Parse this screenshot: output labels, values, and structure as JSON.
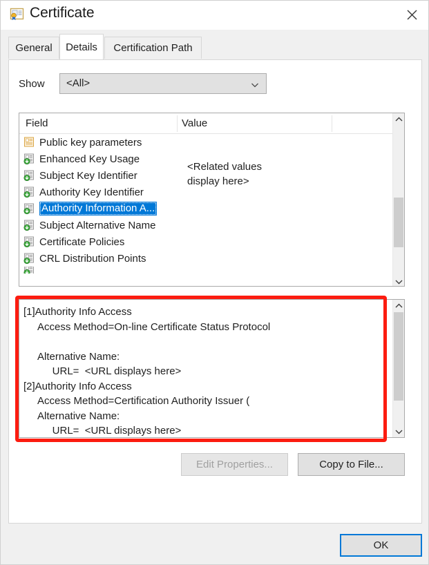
{
  "window": {
    "title": "Certificate",
    "icon": "certificate-icon",
    "close_label": "✕"
  },
  "tabs": [
    {
      "label": "General",
      "selected": false
    },
    {
      "label": "Details",
      "selected": true
    },
    {
      "label": "Certification Path",
      "selected": false
    }
  ],
  "show": {
    "label": "Show",
    "selected_value": "<All>",
    "options": [
      "<All>"
    ]
  },
  "field_list": {
    "columns": [
      "Field",
      "Value"
    ],
    "value_text": "<Related values\ndisplay here>",
    "rows": [
      {
        "label": "Public key parameters",
        "icon": "cert-field-icon-tan",
        "selected": false
      },
      {
        "label": "Enhanced Key Usage",
        "icon": "cert-field-icon",
        "selected": false
      },
      {
        "label": "Subject Key Identifier",
        "icon": "cert-field-icon",
        "selected": false
      },
      {
        "label": "Authority Key Identifier",
        "icon": "cert-field-icon",
        "selected": false
      },
      {
        "label": "Authority Information A...",
        "icon": "cert-field-icon",
        "selected": true
      },
      {
        "label": "Subject Alternative Name",
        "icon": "cert-field-icon",
        "selected": false
      },
      {
        "label": "Certificate Policies",
        "icon": "cert-field-icon",
        "selected": false
      },
      {
        "label": "CRL Distribution Points",
        "icon": "cert-field-icon",
        "selected": false
      }
    ]
  },
  "detail": {
    "text": "[1]Authority Info Access\n     Access Method=On-line Certificate Status Protocol\n\n     Alternative Name:\n          URL=  <URL displays here>\n[2]Authority Info Access\n     Access Method=Certification Authority Issuer (\n     Alternative Name:\n          URL=  <URL displays here>"
  },
  "buttons": {
    "edit_properties": "Edit Properties...",
    "copy_to_file": "Copy to File...",
    "ok": "OK"
  },
  "colors": {
    "selection_blue": "#0078d7",
    "annotation_red": "#fc1c10",
    "dialog_bg": "#f0f0f0",
    "panel_bg": "#ffffff"
  }
}
